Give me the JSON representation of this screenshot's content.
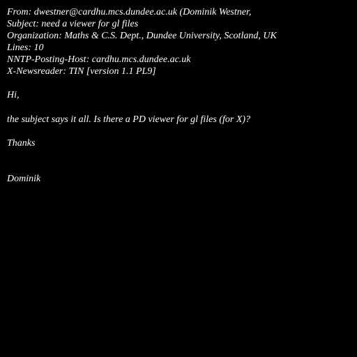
{
  "headers": {
    "from": "From: dwestner@cardhu.mcs.dundee.ac.uk (Dominik Westner,",
    "subject": "Subject: need a viewer for gl files",
    "organization": "Organization: Maths & C.S. Dept., Dundee University, Scotland, UK",
    "lines": "Lines: 10",
    "nntp_host": "NNTP-Posting-Host: cardhu.mcs.dundee.ac.uk",
    "newsreader": "X-Newsreader: TIN [version 1.1 PL9]"
  },
  "body": {
    "greeting": "Hi,",
    "question": "the subject says it all. Is there a PD viewer for gl files (for X)?",
    "thanks": "Thanks",
    "signature": "Dominik"
  }
}
